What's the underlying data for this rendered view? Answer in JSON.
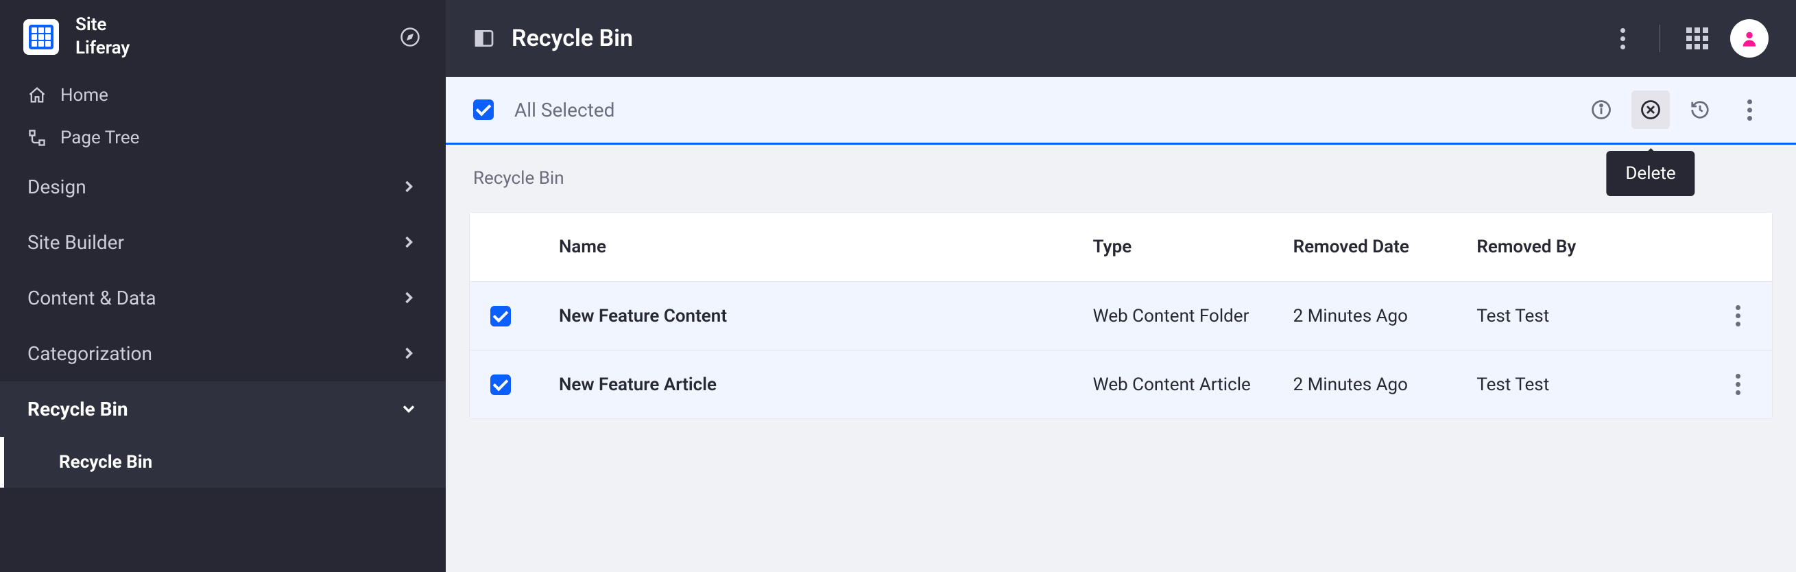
{
  "site": {
    "label1": "Site",
    "label2": "Liferay"
  },
  "sidebar": {
    "home": "Home",
    "page_tree": "Page Tree",
    "sections": [
      {
        "label": "Design"
      },
      {
        "label": "Site Builder"
      },
      {
        "label": "Content & Data"
      },
      {
        "label": "Categorization"
      },
      {
        "label": "Recycle Bin"
      }
    ],
    "active_sub": "Recycle Bin"
  },
  "header": {
    "title": "Recycle Bin"
  },
  "toolbar": {
    "select_label": "All Selected",
    "tooltip_delete": "Delete"
  },
  "breadcrumb": "Recycle Bin",
  "table": {
    "columns": {
      "name": "Name",
      "type": "Type",
      "removed_date": "Removed Date",
      "removed_by": "Removed By"
    },
    "rows": [
      {
        "name": "New Feature Content",
        "type": "Web Content Folder",
        "removed_date": "2 Minutes Ago",
        "removed_by": "Test Test"
      },
      {
        "name": "New Feature Article",
        "type": "Web Content Article",
        "removed_date": "2 Minutes Ago",
        "removed_by": "Test Test"
      }
    ]
  }
}
